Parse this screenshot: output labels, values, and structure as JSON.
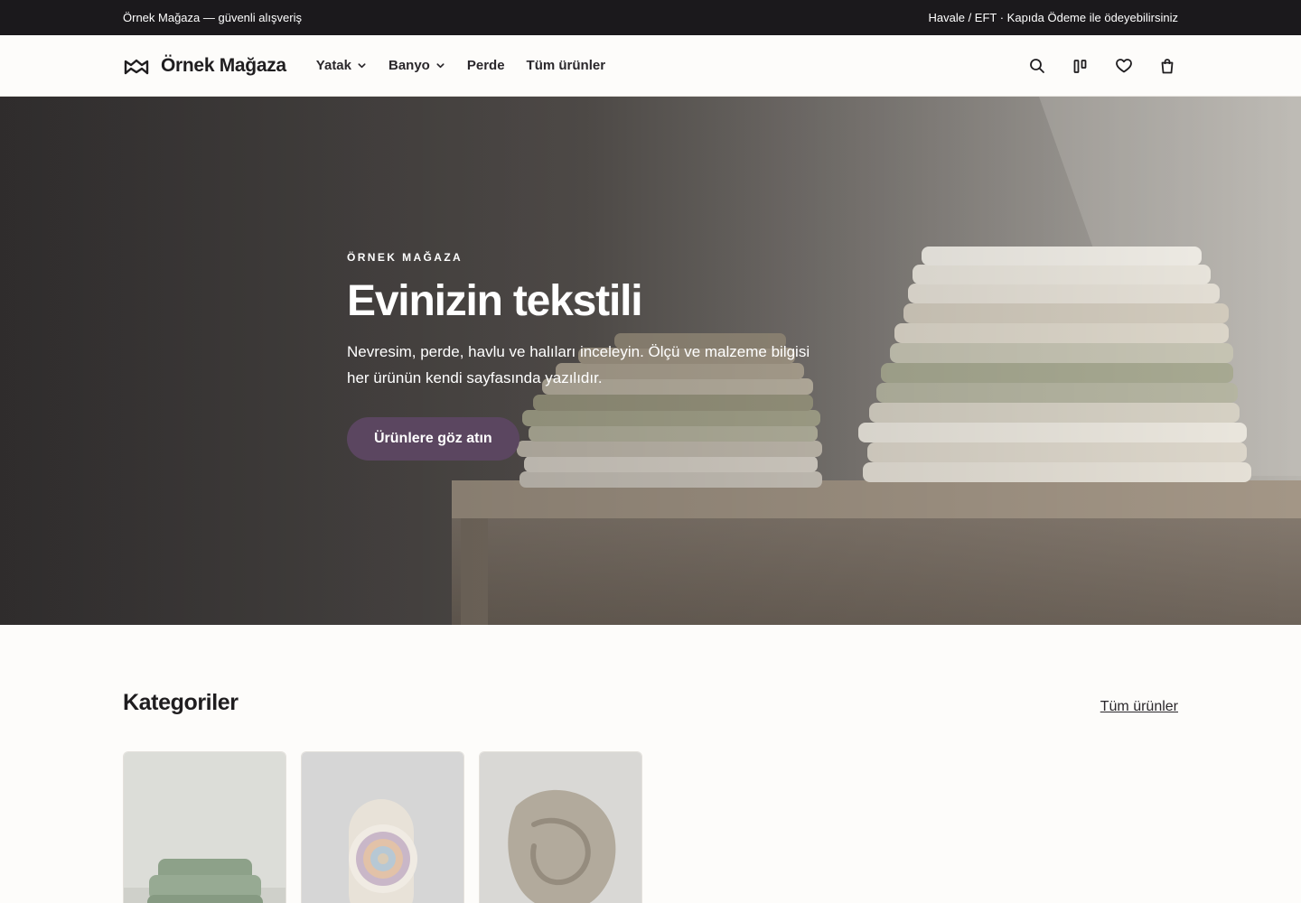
{
  "topbar": {
    "left_text": "Örnek Mağaza — güvenli alışveriş",
    "right_text": "Havale / EFT · Kapıda Ödeme ile ödeyebilirsiniz"
  },
  "header": {
    "brand_name": "Örnek Mağaza",
    "nav": [
      {
        "label": "Yatak",
        "has_dropdown": true
      },
      {
        "label": "Banyo",
        "has_dropdown": true
      },
      {
        "label": "Perde",
        "has_dropdown": false
      },
      {
        "label": "Tüm ürünler",
        "has_dropdown": false
      }
    ],
    "icons": [
      "search-icon",
      "compare-icon",
      "heart-icon",
      "shopping-bag-icon"
    ]
  },
  "hero": {
    "eyebrow": "ÖRNEK MAĞAZA",
    "title": "Evinizin tekstili",
    "text": "Nevresim, perde, havlu ve halıları inceleyin. Ölçü ve malzeme bilgisi her ürünün kendi sayfasında yazılıdır.",
    "cta_label": "Ürünlere göz atın"
  },
  "categories": {
    "title": "Kategoriler",
    "link_label": "Tüm ürünler",
    "cards": [
      {
        "image": "green bedding set on bed"
      },
      {
        "image": "rolled striped towel"
      },
      {
        "image": "draped beige throw blanket"
      }
    ]
  },
  "colors": {
    "topbar_bg": "#1b191c",
    "page_bg": "#fdfcfa",
    "cta_bg": "#5b4660",
    "text": "#1f1d1f"
  }
}
